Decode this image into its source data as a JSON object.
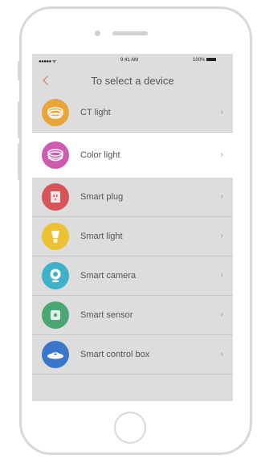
{
  "status": {
    "signal": "●●●●● ᯤ",
    "time": "9:41 AM",
    "battery": "100%"
  },
  "header": {
    "title": "To select a device"
  },
  "devices": [
    {
      "label": "CT light",
      "icon": "ct-light-icon",
      "color": "#e9a53a"
    },
    {
      "label": "Color light",
      "icon": "color-light-icon",
      "color": "#cd5bb0"
    },
    {
      "label": "Smart plug",
      "icon": "smart-plug-icon",
      "color": "#d65559"
    },
    {
      "label": "Smart light",
      "icon": "smart-light-icon",
      "color": "#ecc133"
    },
    {
      "label": "Smart camera",
      "icon": "smart-camera-icon",
      "color": "#3fb2c9"
    },
    {
      "label": "Smart sensor",
      "icon": "smart-sensor-icon",
      "color": "#4aa773"
    },
    {
      "label": "Smart control box",
      "icon": "control-box-icon",
      "color": "#3a76c9"
    }
  ],
  "chevron": "›"
}
